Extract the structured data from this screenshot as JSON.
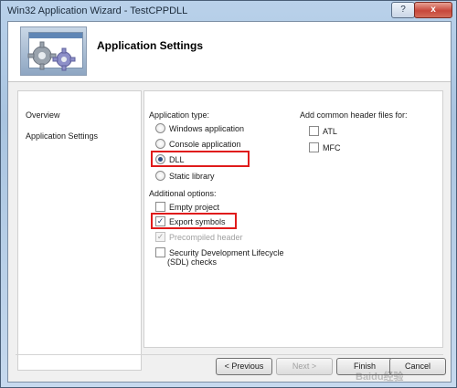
{
  "window": {
    "title": "Win32 Application Wizard - TestCPPDLL",
    "help_label": "?",
    "close_label": "x"
  },
  "header": {
    "title": "Application Settings"
  },
  "sidebar": {
    "items": [
      {
        "label": "Overview"
      },
      {
        "label": "Application Settings"
      }
    ]
  },
  "app_type": {
    "label": "Application type:",
    "options": [
      {
        "label": "Windows application",
        "selected": false
      },
      {
        "label": "Console application",
        "selected": false
      },
      {
        "label": "DLL",
        "selected": true
      },
      {
        "label": "Static library",
        "selected": false
      }
    ]
  },
  "additional": {
    "label": "Additional options:",
    "options": [
      {
        "label": "Empty project",
        "checked": false,
        "enabled": true
      },
      {
        "label": "Export symbols",
        "checked": true,
        "enabled": true
      },
      {
        "label": "Precompiled header",
        "checked": true,
        "enabled": false
      },
      {
        "label": "Security Development Lifecycle",
        "label2": "(SDL) checks",
        "checked": false,
        "enabled": true
      }
    ]
  },
  "headers": {
    "label": "Add common header files for:",
    "options": [
      {
        "label": "ATL",
        "checked": false
      },
      {
        "label": "MFC",
        "checked": false
      }
    ]
  },
  "buttons": {
    "previous": "< Previous",
    "next": "Next >",
    "finish": "Finish",
    "cancel": "Cancel"
  },
  "watermark": "Baidu经验",
  "colors": {
    "highlight": "#e01b1b",
    "accent": "#2d4f83"
  }
}
